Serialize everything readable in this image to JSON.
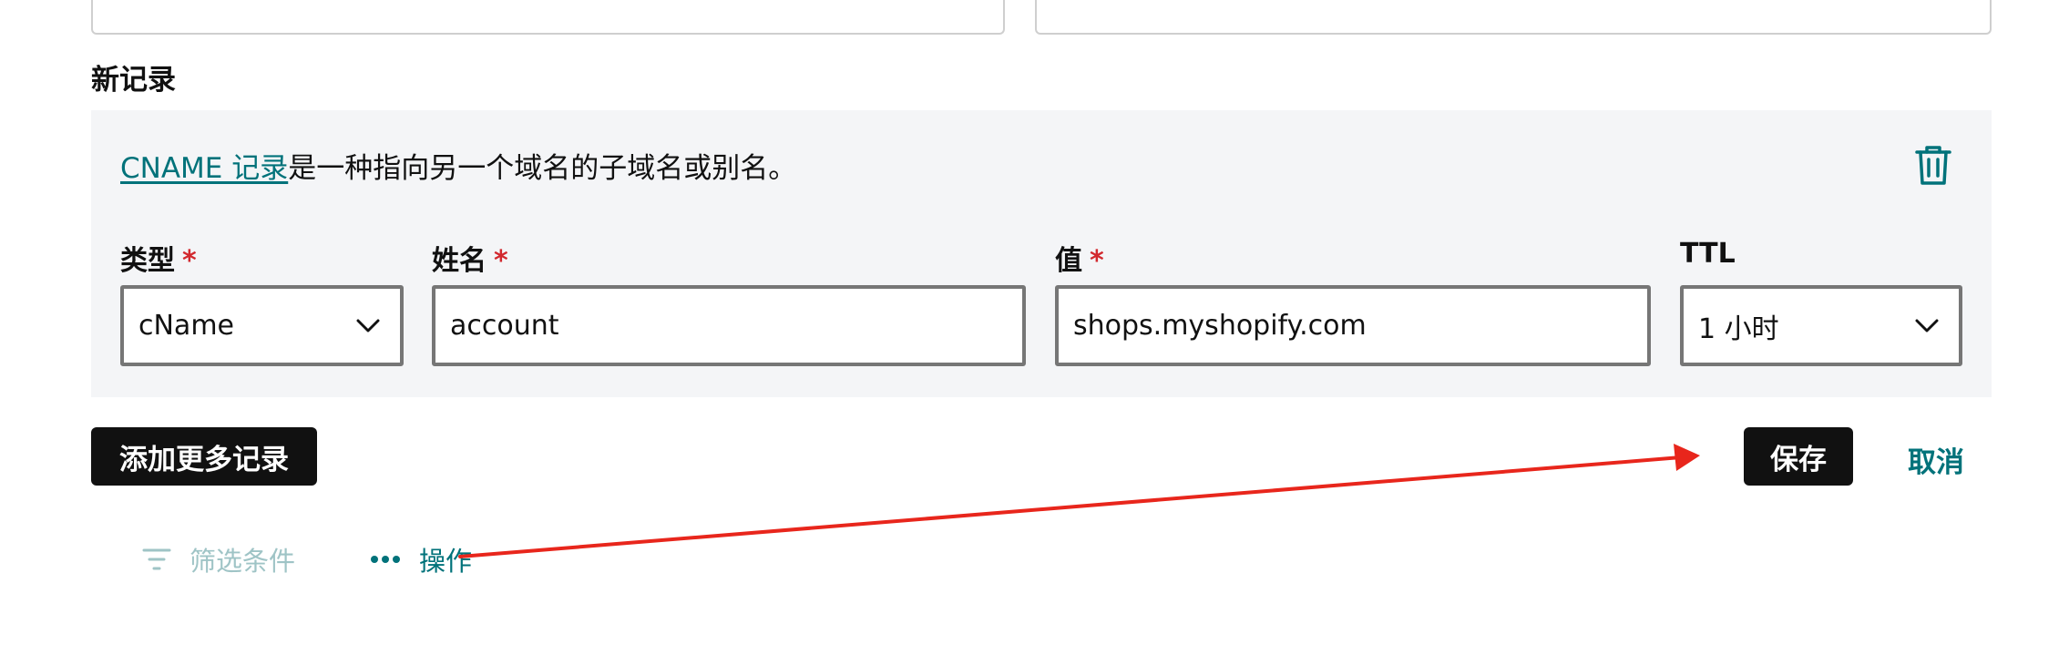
{
  "section": {
    "title": "新记录"
  },
  "record": {
    "description_link": "CNAME 记录",
    "description_rest": "是一种指向另一个域名的子域名或别名。",
    "delete_icon": "trash-icon"
  },
  "fields": {
    "type": {
      "label": "类型",
      "required_mark": "*",
      "value": "cName"
    },
    "name": {
      "label": "姓名",
      "required_mark": "*",
      "value": "account"
    },
    "value": {
      "label": "值",
      "required_mark": "*",
      "value": "shops.myshopify.com"
    },
    "ttl": {
      "label": "TTL",
      "value": "1 小时"
    }
  },
  "actions": {
    "add_more": "添加更多记录",
    "save": "保存",
    "cancel": "取消"
  },
  "toolbar": {
    "filter": "筛选条件",
    "operations": "操作"
  },
  "colors": {
    "accent": "#00727a",
    "required": "#d2282e",
    "annotation_arrow": "#e8261c"
  }
}
